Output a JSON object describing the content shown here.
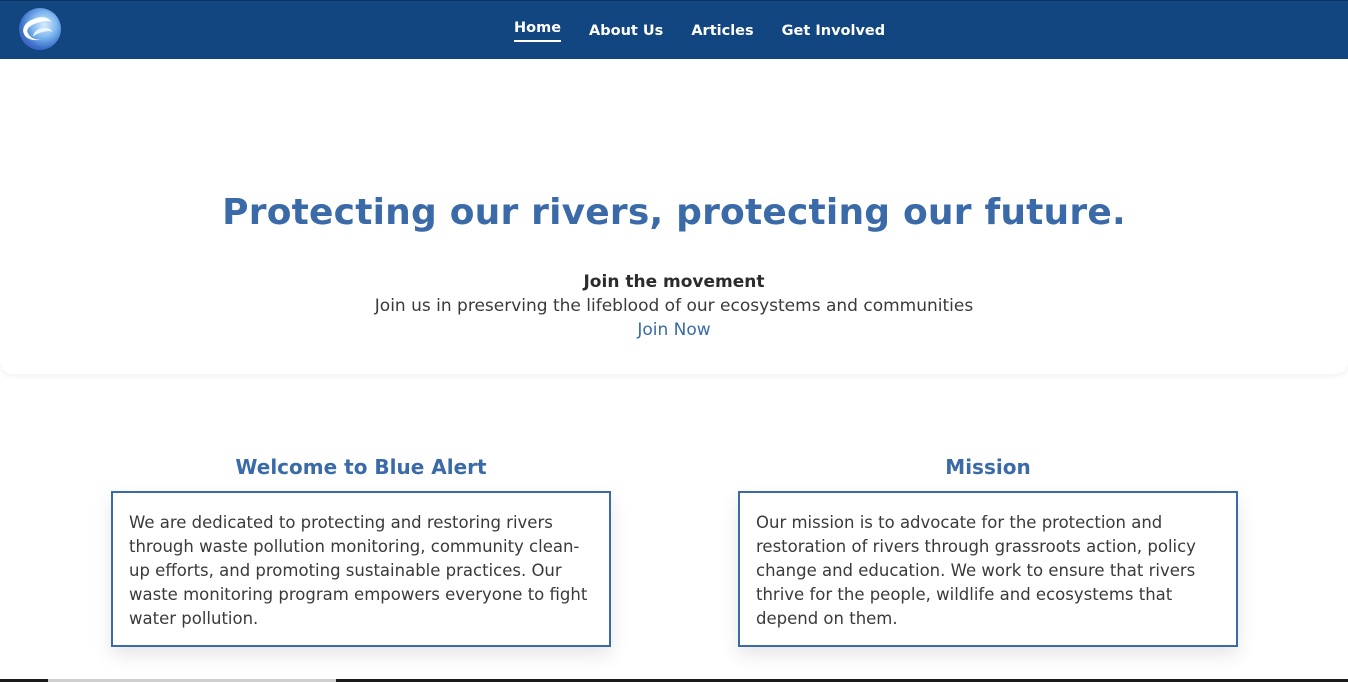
{
  "nav": {
    "logo_icon": "wave-logo-icon",
    "links": [
      {
        "label": "Home",
        "active": true
      },
      {
        "label": "About Us",
        "active": false
      },
      {
        "label": "Articles",
        "active": false
      },
      {
        "label": "Get Involved",
        "active": false
      }
    ]
  },
  "hero": {
    "title": "Protecting our rivers, protecting our future.",
    "subheading": "Join the movement",
    "text": "Join us in preserving the lifeblood of our ecosystems and communities",
    "cta": "Join Now"
  },
  "sections": [
    {
      "title": "Welcome to Blue Alert",
      "body": "We are dedicated to protecting and restoring rivers through waste pollution monitoring, community clean-up efforts, and promoting sustainable practices. Our waste monitoring program empowers everyone to fight water pollution."
    },
    {
      "title": "Mission",
      "body": "Our mission is to advocate for the protection and restoration of rivers through grassroots action, policy change and education. We work to ensure that rivers thrive for the people, wildlife and ecosystems that depend on them."
    }
  ],
  "colors": {
    "navbar": "#124680",
    "accent": "#3a6aa8",
    "text": "#3a3a3a"
  }
}
